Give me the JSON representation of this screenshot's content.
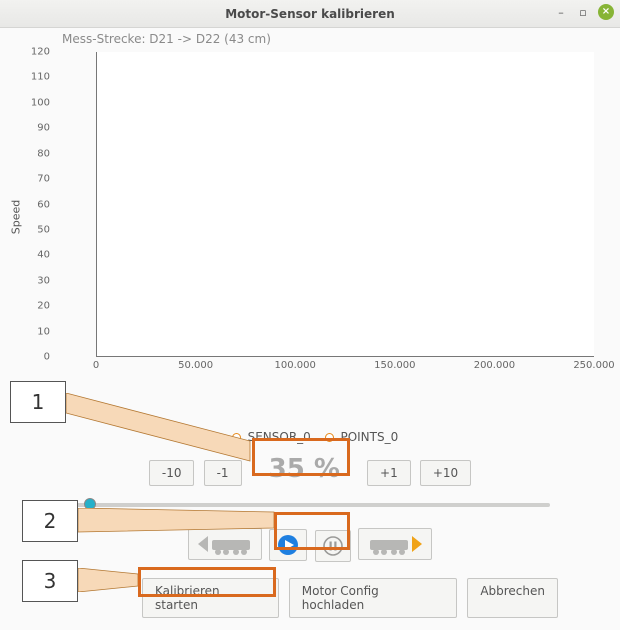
{
  "window": {
    "title": "Motor-Sensor kalibrieren"
  },
  "subtitle": "Mess-Strecke: D21 -> D22 (43 cm)",
  "chart_data": {
    "type": "scatter",
    "ylabel": "Speed",
    "ylim": [
      0,
      120
    ],
    "xlim": [
      0,
      250000
    ],
    "y_ticks": [
      0,
      10,
      20,
      30,
      40,
      50,
      60,
      70,
      80,
      90,
      100,
      110,
      120
    ],
    "x_ticks": [
      "0",
      "50.000",
      "100.000",
      "150.000",
      "200.000",
      "250.000"
    ],
    "series": [
      {
        "name": "SENSOR_0",
        "values": []
      },
      {
        "name": "POINTS_0",
        "values": []
      }
    ]
  },
  "stepper": {
    "minus10": "-10",
    "minus1": "-1",
    "value": "35 %",
    "plus1": "+1",
    "plus10": "+10"
  },
  "slider": {
    "valuePercent": 3
  },
  "buttons": {
    "start": "Kalibrieren starten",
    "upload": "Motor Config hochladen",
    "cancel": "Abbrechen"
  },
  "callouts": {
    "a": "1",
    "b": "2",
    "c": "3"
  }
}
